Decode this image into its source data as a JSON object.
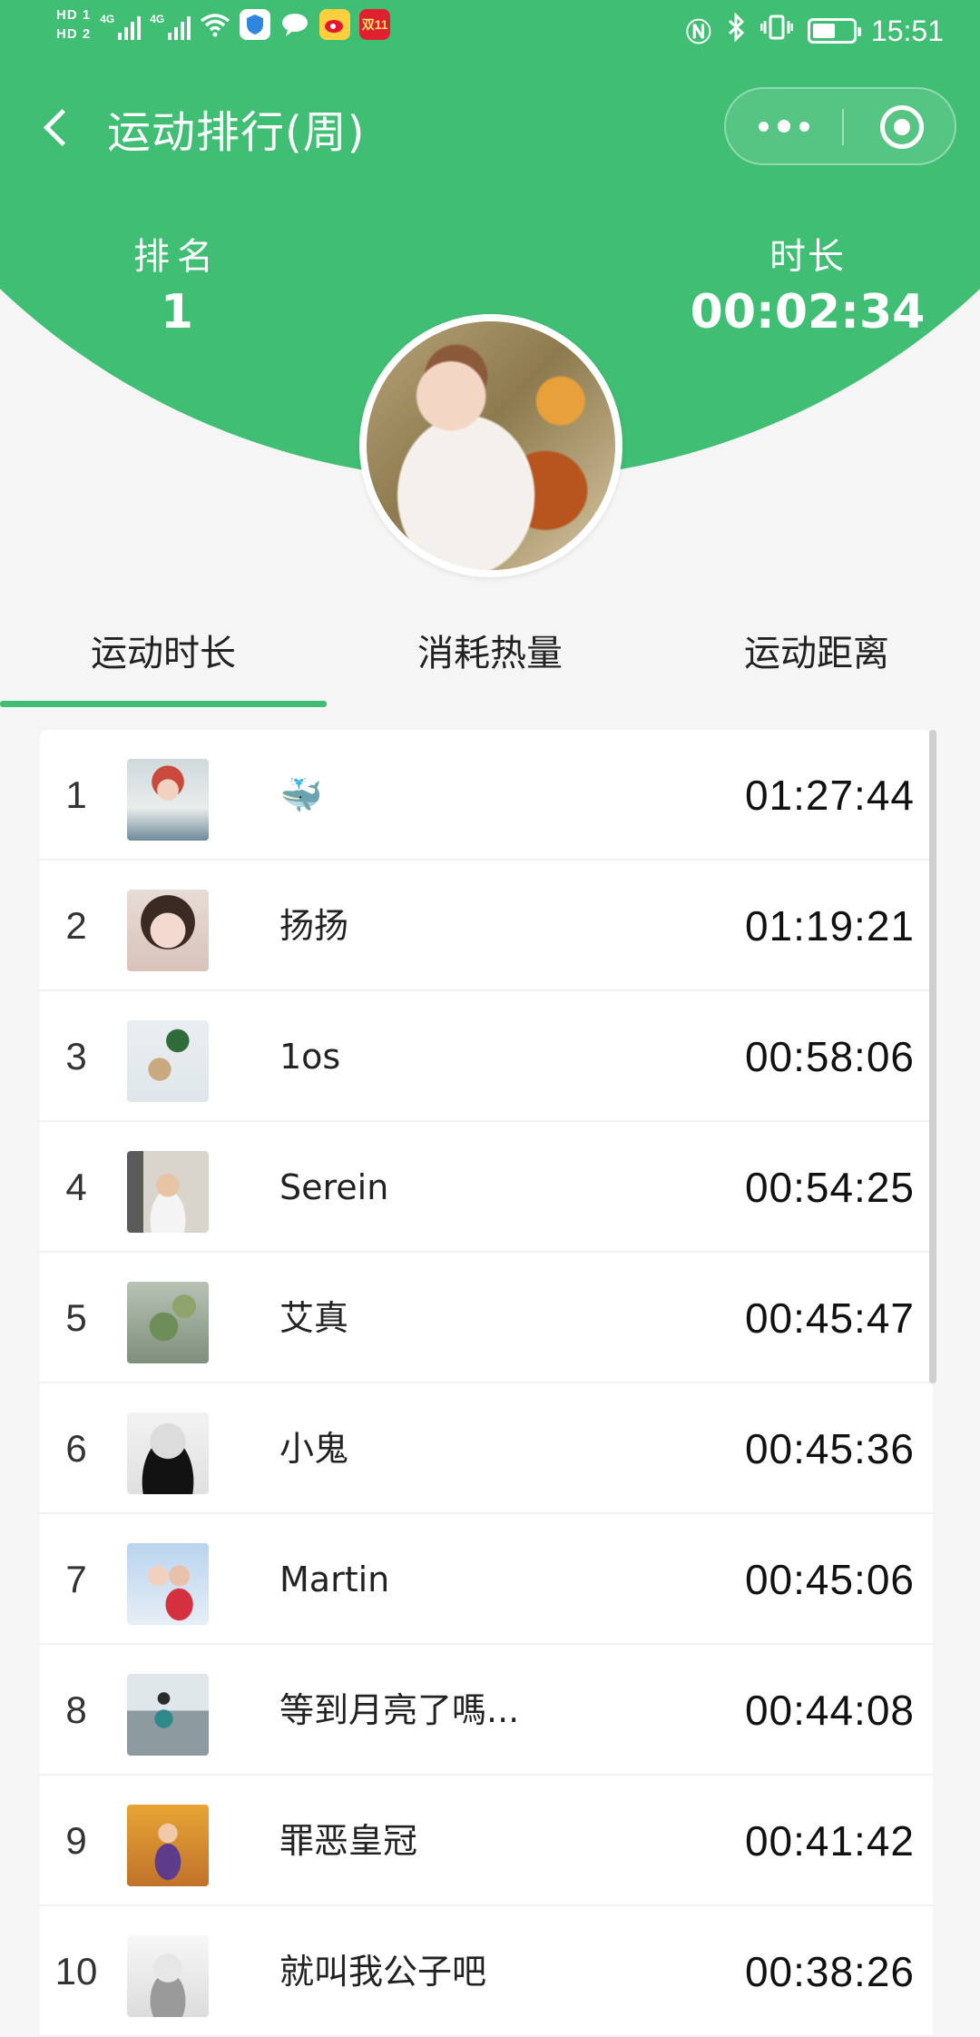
{
  "status_bar": {
    "hd1": "HD 1",
    "hd2": "HD 2",
    "net1": "4G",
    "net2": "4G",
    "badge_text": "双11",
    "time": "15:51"
  },
  "nav": {
    "title": "运动排行(周)"
  },
  "summary": {
    "rank_label": "排名",
    "rank_value": "1",
    "duration_label": "时长",
    "duration_value": "00:02:34"
  },
  "tabs": [
    {
      "label": "运动时长",
      "active": true
    },
    {
      "label": "消耗热量",
      "active": false
    },
    {
      "label": "运动距离",
      "active": false
    }
  ],
  "ranking": [
    {
      "rank": "1",
      "name": "🐳",
      "duration": "01:27:44"
    },
    {
      "rank": "2",
      "name": "扬扬",
      "duration": "01:19:21"
    },
    {
      "rank": "3",
      "name": "1os",
      "duration": "00:58:06"
    },
    {
      "rank": "4",
      "name": "Serein",
      "duration": "00:54:25"
    },
    {
      "rank": "5",
      "name": "艾真",
      "duration": "00:45:47"
    },
    {
      "rank": "6",
      "name": "小鬼",
      "duration": "00:45:36"
    },
    {
      "rank": "7",
      "name": "Martin",
      "duration": "00:45:06"
    },
    {
      "rank": "8",
      "name": "等到月亮了嗎...",
      "duration": "00:44:08"
    },
    {
      "rank": "9",
      "name": "罪恶皇冠",
      "duration": "00:41:42"
    },
    {
      "rank": "10",
      "name": "就叫我公子吧",
      "duration": "00:38:26"
    }
  ],
  "colors": {
    "accent": "#3fbe74",
    "background": "#f5f5f5"
  }
}
